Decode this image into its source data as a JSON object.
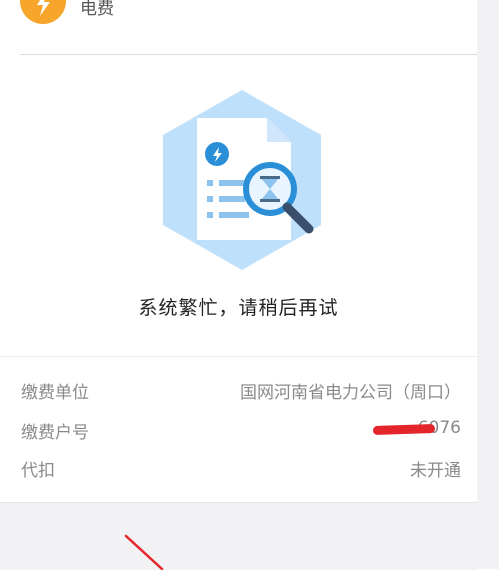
{
  "header": {
    "icon": "lightning-icon",
    "title": "电费"
  },
  "status": {
    "illustration": "document-search-icon",
    "message": "系统繁忙，请稍后再试"
  },
  "details": {
    "rows": [
      {
        "label": "缴费单位",
        "value": "国网河南省电力公司（周口）"
      },
      {
        "label": "缴费户号",
        "value": "6076"
      },
      {
        "label": "代扣",
        "value": "未开通"
      }
    ]
  },
  "colors": {
    "accent_orange": "#f7a52b",
    "illustration_blue": "#bfe0fb",
    "redaction_red": "#e4252c",
    "footer_gray": "#f2f2f4"
  }
}
